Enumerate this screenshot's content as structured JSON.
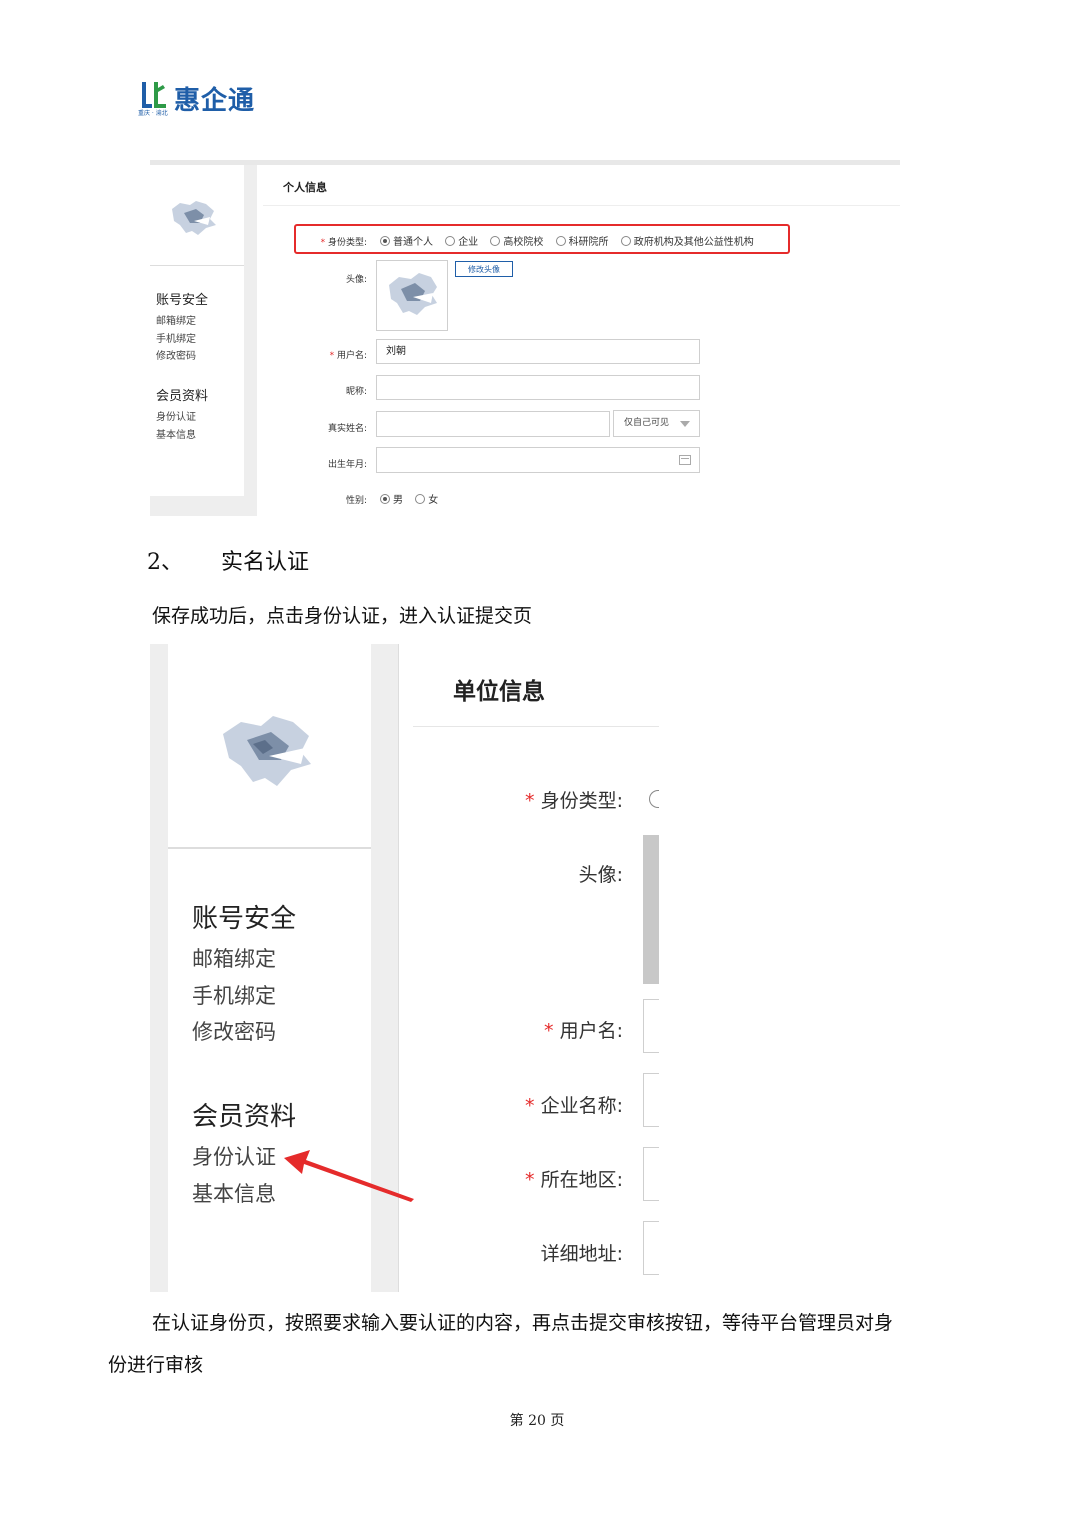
{
  "logo": {
    "text": "惠企通",
    "subtitle": "重庆 · 渝北"
  },
  "shot1": {
    "sidebar": {
      "group1": "账号安全",
      "group1_links": [
        "邮箱绑定",
        "手机绑定",
        "修改密码"
      ],
      "group2": "会员资料",
      "group2_links": [
        "身份认证",
        "基本信息"
      ]
    },
    "title": "个人信息",
    "identity_label": "身份类型:",
    "identity_options": [
      "普通个人",
      "企业",
      "高校院校",
      "科研院所",
      "政府机构及其他公益性机构"
    ],
    "identity_selected": "普通个人",
    "avatar_label": "头像:",
    "avatar_button": "修改头像",
    "username_label": "用户名:",
    "username_value": "刘朝",
    "nickname_label": "昵称:",
    "realname_label": "真实姓名:",
    "visibility_select": "仅自己可见",
    "birth_label": "出生年月:",
    "gender_label": "性别:",
    "gender_options": [
      "男",
      "女"
    ],
    "gender_selected": "男"
  },
  "section": {
    "number": "2、",
    "heading": "实名认证"
  },
  "paragraph1": "保存成功后，点击身份认证，进入认证提交页",
  "shot2": {
    "sidebar": {
      "group1": "账号安全",
      "group1_links": [
        "邮箱绑定",
        "手机绑定",
        "修改密码"
      ],
      "group2": "会员资料",
      "group2_links": [
        "身份认证",
        "基本信息"
      ]
    },
    "title": "单位信息",
    "labels": {
      "identity": "身份类型:",
      "avatar": "头像:",
      "username": "用户名:",
      "company": "企业名称:",
      "region": "所在地区:",
      "address": "详细地址:"
    },
    "arrow_color": "#e52b2b"
  },
  "paragraph2_line1": "在认证身份页，按照要求输入要认证的内容，再点击提交审核按钮，等待平台管理员对身",
  "paragraph2_line2": "份进行审核",
  "footer": "第 20 页",
  "colors": {
    "brand": "#1f5ea8",
    "required": "#e52b2b",
    "highlight_box": "#e52b2b"
  }
}
